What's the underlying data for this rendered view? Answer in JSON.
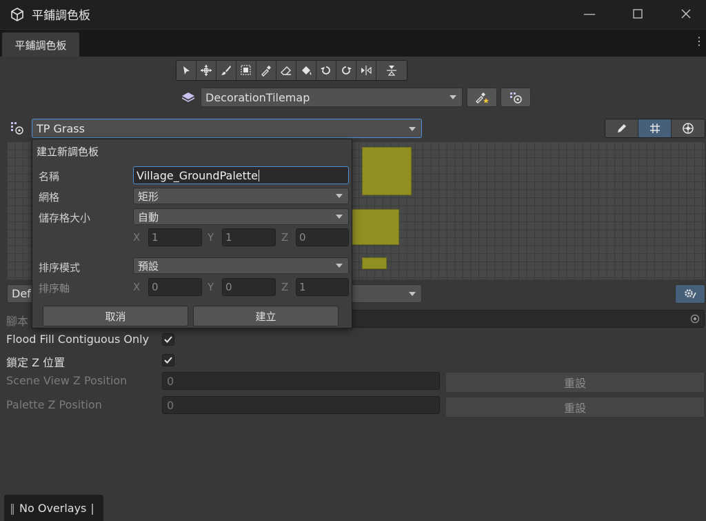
{
  "window": {
    "title": "平鋪調色板"
  },
  "tabs": [
    {
      "label": "平鋪調色板"
    }
  ],
  "toolbar": {
    "active_tilemap": "DecorationTilemap"
  },
  "palette": {
    "selected": "TP Grass"
  },
  "brush": {
    "selected": "Def"
  },
  "popup": {
    "header": "建立新調色板",
    "name_label": "名稱",
    "name_value": "Village_GroundPalette",
    "grid_label": "網格",
    "grid_value": "矩形",
    "cell_size_label": "儲存格大小",
    "cell_size_value": "自動",
    "cell_x": "1",
    "cell_y": "1",
    "cell_z": "0",
    "sort_mode_label": "排序模式",
    "sort_mode_value": "預設",
    "sort_axis_label": "排序軸",
    "sort_x": "0",
    "sort_y": "0",
    "sort_z": "1",
    "axis_x": "X",
    "axis_y": "Y",
    "axis_z": "Z",
    "cancel_label": "取消",
    "create_label": "建立"
  },
  "settings": {
    "script_label": "腳本",
    "flood_fill_label": "Flood Fill Contiguous Only",
    "flood_fill_checked": true,
    "lock_z_label": "鎖定 Z 位置",
    "lock_z_checked": true,
    "scene_z_label": "Scene View Z Position",
    "scene_z_value": "0",
    "palette_z_label": "Palette Z Position",
    "palette_z_value": "0",
    "reset_label": "重設"
  },
  "overlays": {
    "label": "No Overlays"
  },
  "colors": {
    "accent": "#4d90d6",
    "tile": "#8f8f22",
    "background": "#383838"
  }
}
